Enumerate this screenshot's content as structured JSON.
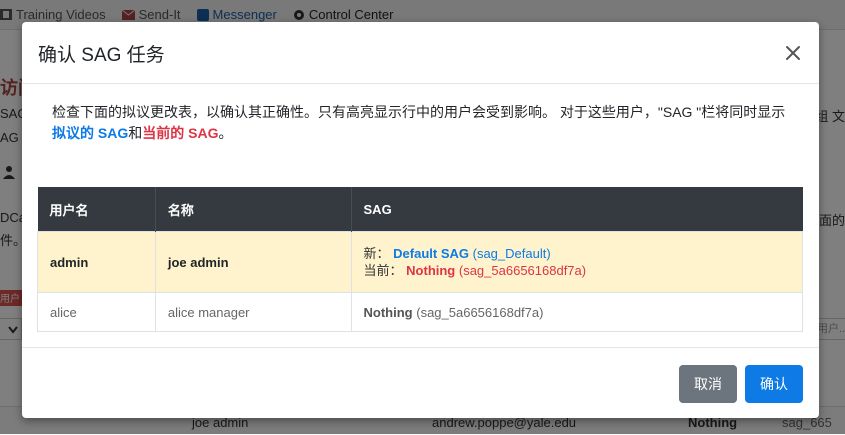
{
  "background": {
    "nav": [
      {
        "label": "Training Videos",
        "icon": "film-icon"
      },
      {
        "label": "Send-It",
        "icon": "envelope-icon"
      },
      {
        "label": "Messenger",
        "icon": "messenger-icon"
      },
      {
        "label": "Control Center",
        "icon": "gear-icon"
      }
    ],
    "title_fragment": "访问",
    "text_fragments": [
      "SAG",
      "AG 。",
      "DCa",
      "件。"
    ],
    "right_fragments": [
      "-组 文",
      "面的"
    ],
    "user_badge": "用户",
    "filter_placeholder": "用户...",
    "row": {
      "full_name": "joe admin",
      "email": "andrew.poppe@yale.edu",
      "sag_name": "Nothing",
      "sag_id": "sag_665"
    }
  },
  "modal": {
    "title": "确认 SAG 任务",
    "intro": {
      "text": "检查下面的拟议更改表，以确认其正确性。只有高亮显示行中的用户会受到影响。 对于这些用户，\"SAG \"栏将同时显示",
      "proposed": "拟议的 SAG",
      "and": "和",
      "current": "当前的 SAG",
      "end": "。"
    },
    "table": {
      "headers": [
        "用户名",
        "名称",
        "SAG"
      ],
      "rows": [
        {
          "username": "admin",
          "name": "joe admin",
          "highlighted": true,
          "new_prefix": "新：",
          "new_sag_name": "Default SAG",
          "new_sag_id": "(sag_Default)",
          "current_prefix": "当前：",
          "current_sag_name": "Nothing",
          "current_sag_id": "(sag_5a6656168df7a)"
        },
        {
          "username": "alice",
          "name": "alice manager",
          "highlighted": false,
          "sag_name": "Nothing",
          "sag_id": "(sag_5a6656168df7a)"
        }
      ]
    },
    "buttons": {
      "cancel": "取消",
      "confirm": "确认"
    }
  },
  "colors": {
    "accent": "#0d7ae6",
    "danger": "#dc3545",
    "header_dark": "#343a40",
    "highlight_row": "#fff3cd",
    "cancel_button": "#6c757d"
  }
}
